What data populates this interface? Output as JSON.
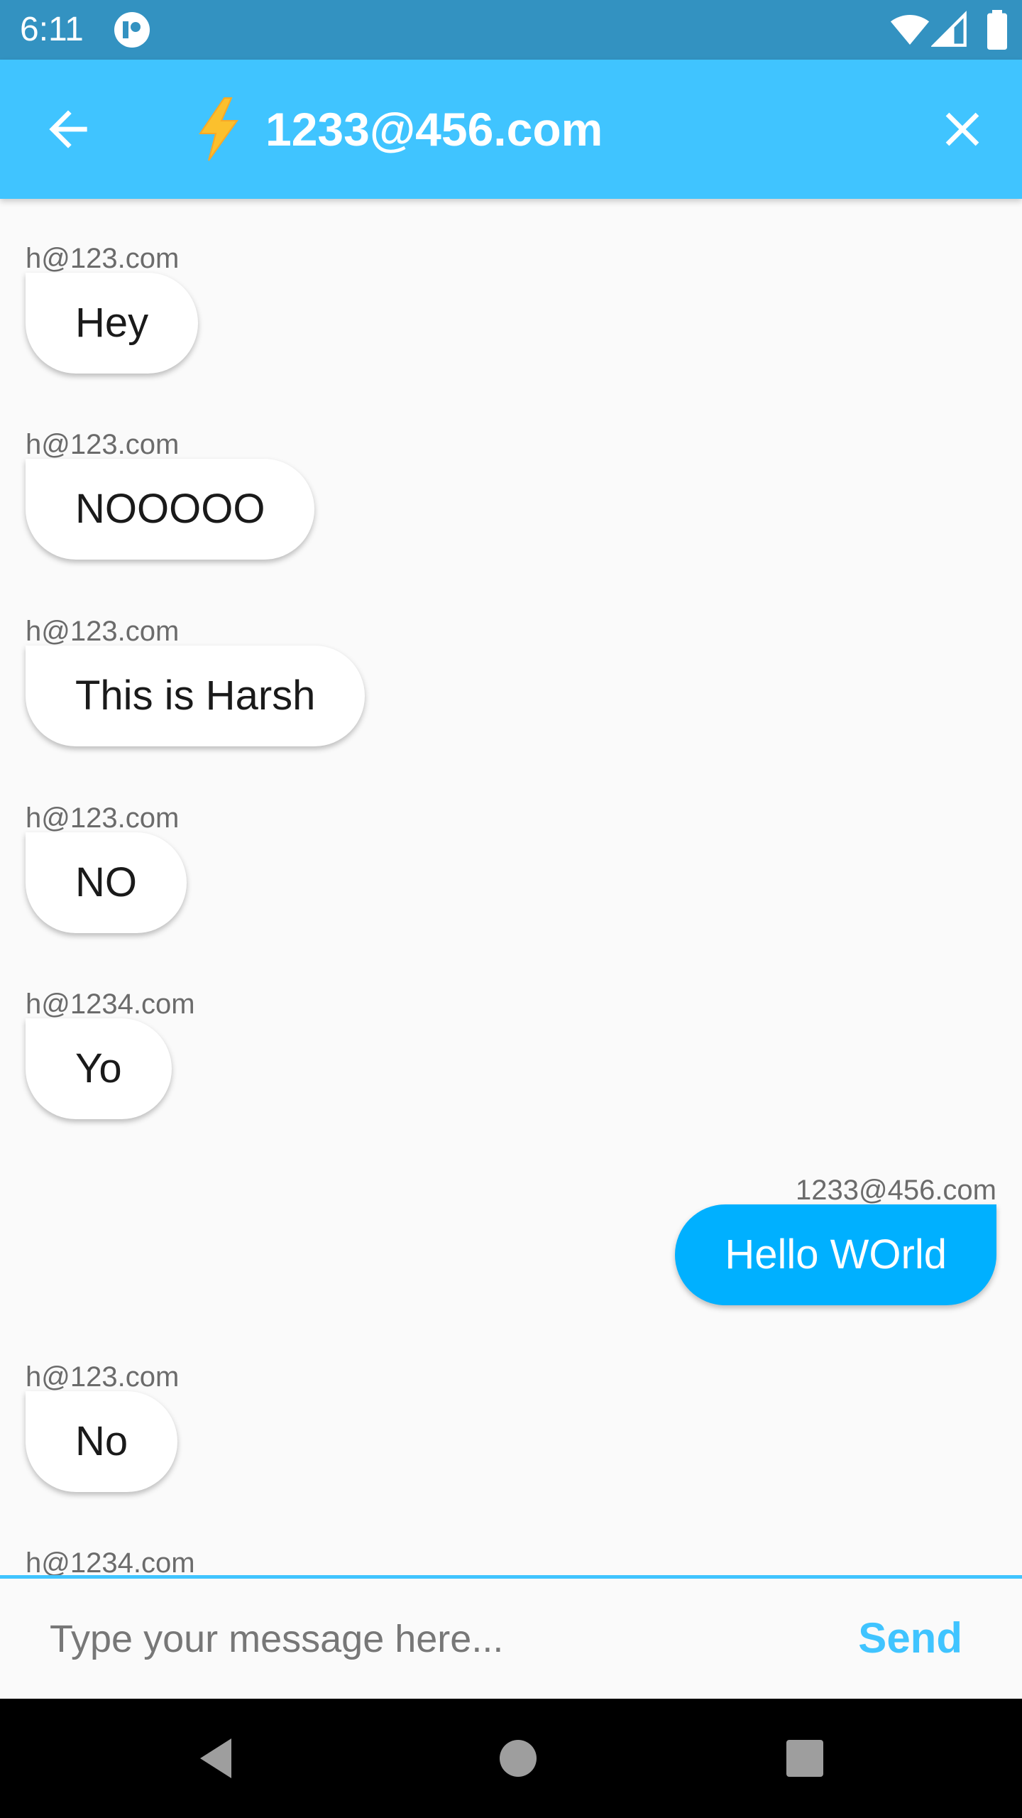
{
  "status_bar": {
    "time": "6:11",
    "icons": [
      "app-notification-icon",
      "wifi-icon",
      "cell-signal-icon",
      "battery-icon"
    ]
  },
  "app_bar": {
    "title": "1233@456.com",
    "title_icon": "lightning-bolt-icon",
    "back_icon": "arrow-back-icon",
    "close_icon": "close-icon",
    "background_color": "#40c4ff"
  },
  "messages": [
    {
      "sender": "h@123.com",
      "text": "Hey",
      "side": "left"
    },
    {
      "sender": "h@123.com",
      "text": "NOOOOO",
      "side": "left"
    },
    {
      "sender": "h@123.com",
      "text": "This is Harsh",
      "side": "left"
    },
    {
      "sender": "h@123.com",
      "text": "NO",
      "side": "left"
    },
    {
      "sender": "h@1234.com",
      "text": "Yo",
      "side": "left"
    },
    {
      "sender": "1233@456.com",
      "text": "Hello WOrld",
      "side": "right"
    },
    {
      "sender": "h@123.com",
      "text": "No",
      "side": "left"
    },
    {
      "sender": "h@1234.com",
      "text": "",
      "side": "left"
    }
  ],
  "composer": {
    "placeholder": "Type your message here...",
    "value": "",
    "send_label": "Send"
  },
  "colors": {
    "status_bar": "#3392c1",
    "accent": "#40c4ff",
    "own_bubble": "#00b0ff",
    "other_bubble": "#ffffff"
  },
  "nav_bar": {
    "icons": [
      "nav-back-icon",
      "nav-home-icon",
      "nav-recents-icon"
    ]
  }
}
